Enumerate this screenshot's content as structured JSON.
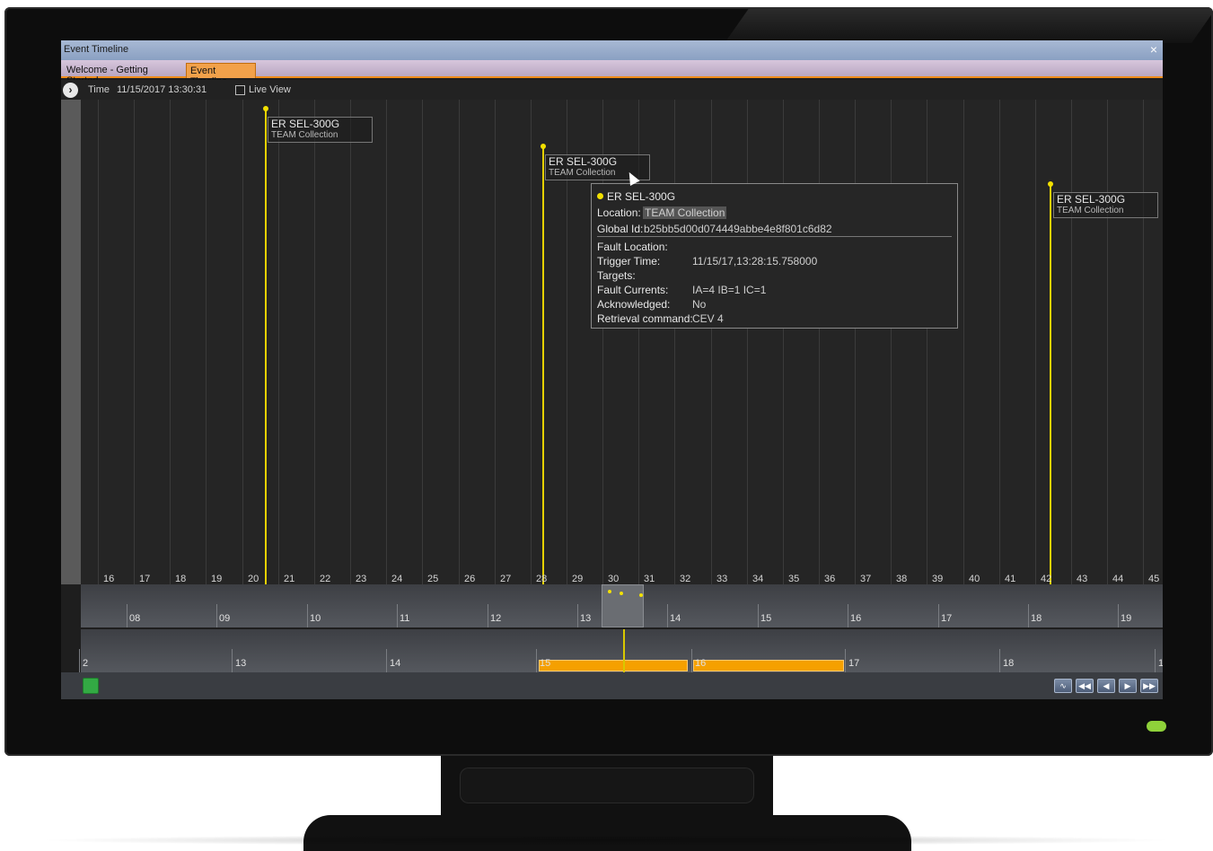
{
  "window": {
    "title": "Event Timeline",
    "close_glyph": "×"
  },
  "tabs": [
    {
      "label": "Welcome - Getting Started"
    },
    {
      "label": "Event Timeline"
    }
  ],
  "toolbar": {
    "expand_glyph": "›",
    "time_label": "Time",
    "time_value": "11/15/2017 13:30:31",
    "live_view_label": "Live View",
    "live_view_checked": false
  },
  "timeline": {
    "ticks": [
      "16",
      "17",
      "18",
      "19",
      "20",
      "21",
      "22",
      "23",
      "24",
      "25",
      "26",
      "27",
      "28",
      "29",
      "30",
      "31",
      "32",
      "33",
      "34",
      "35",
      "36",
      "37",
      "38",
      "39",
      "40",
      "41",
      "42",
      "43",
      "44",
      "45"
    ],
    "events": [
      {
        "name": "ER SEL-300G",
        "collection": "TEAM Collection"
      },
      {
        "name": "ER SEL-300G",
        "collection": "TEAM Collection"
      },
      {
        "name": "ER SEL-300G",
        "collection": "TEAM Collection"
      }
    ]
  },
  "tooltip": {
    "title": "ER SEL-300G",
    "location_label": "Location:",
    "location_value": "TEAM Collection",
    "global_id_label": "Global Id:",
    "global_id_value": "b25bb5d00d074449abbe4e8f801c6d82",
    "fault_location_label": "Fault Location:",
    "trigger_time_label": "Trigger Time:",
    "trigger_time_value": "11/15/17,13:28:15.758000",
    "targets_label": "Targets:",
    "fault_currents_label": "Fault Currents:",
    "fault_currents_value": "IA=4 IB=1 IC=1",
    "acknowledged_label": "Acknowledged:",
    "acknowledged_value": "No",
    "retrieval_label": "Retrieval command:",
    "retrieval_value": "CEV 4"
  },
  "overview_minutes": [
    "08",
    "09",
    "10",
    "11",
    "12",
    "13",
    "14",
    "15",
    "16",
    "17",
    "18",
    "19"
  ],
  "overview_hours": [
    "2",
    "13",
    "14",
    "15",
    "16",
    "17",
    "18",
    "1"
  ],
  "colors": {
    "accent": "#f08c1a",
    "event": "#e5d100",
    "band": "#f5a000"
  },
  "bottom_icons": [
    "list-icon",
    "waveform-icon",
    "skip-back-icon",
    "step-back-icon",
    "step-forward-icon",
    "skip-forward-icon"
  ]
}
